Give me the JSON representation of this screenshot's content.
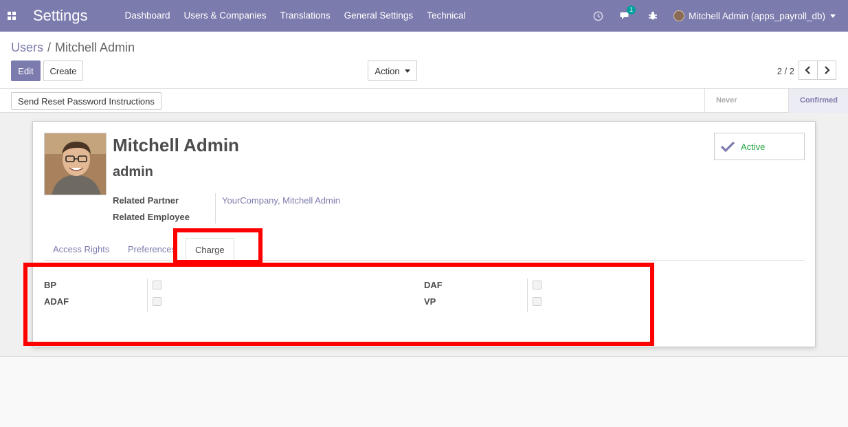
{
  "navbar": {
    "app_title": "Settings",
    "menu": [
      "Dashboard",
      "Users & Companies",
      "Translations",
      "General Settings",
      "Technical"
    ],
    "chat_badge": "1",
    "user_label": "Mitchell Admin (apps_payroll_db)"
  },
  "control": {
    "breadcrumb_parent": "Users",
    "breadcrumb_sep": "/",
    "breadcrumb_current": "Mitchell Admin",
    "edit_label": "Edit",
    "create_label": "Create",
    "action_label": "Action",
    "pager": "2 / 2"
  },
  "statusbar": {
    "reset_button": "Send Reset Password Instructions",
    "steps": [
      "Never Connected",
      "Confirmed"
    ],
    "current_step": "Confirmed"
  },
  "form": {
    "name": "Mitchell Admin",
    "login": "admin",
    "active_label": "Active",
    "related_partner_label": "Related Partner",
    "related_partner_value": "YourCompany, Mitchell Admin",
    "related_employee_label": "Related Employee",
    "tabs": [
      "Access Rights",
      "Preferences",
      "Charge"
    ],
    "active_tab": "Charge",
    "charge_fields": {
      "bp": "BP",
      "adaf": "ADAF",
      "daf": "DAF",
      "vp": "VP"
    }
  },
  "colors": {
    "brand": "#7c7bad",
    "active_green": "#28a745",
    "highlight": "#ff0000"
  }
}
